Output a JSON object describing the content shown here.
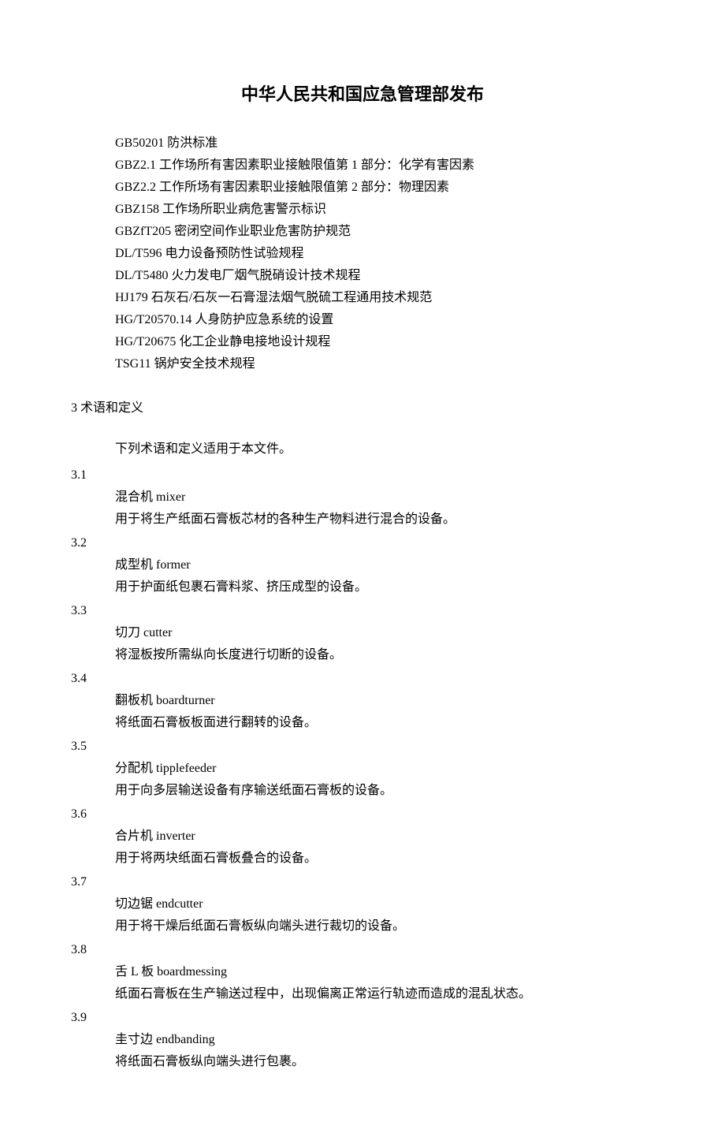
{
  "title": "中华人民共和国应急管理部发布",
  "standards": [
    "GB50201 防洪标准",
    "GBZ2.1 工作场所有害因素职业接触限值第 1 部分：化学有害因素",
    "GBZ2.2 工作所场有害因素职业接触限值第 2 部分：物理因素",
    "GBZ158 工作场所职业病危害警示标识",
    "GBZfT205 密闭空间作业职业危害防护规范",
    "DL/T596 电力设备预防性试验规程",
    "DL/T5480 火力发电厂烟气脱硝设计技术规程",
    "HJ179 石灰石/石灰一石膏湿法烟气脱硫工程通用技术规范",
    "HG/T20570.14 人身防护应急系统的设置",
    "HG/T20675 化工企业静电接地设计规程",
    "TSG11 锅炉安全技术规程"
  ],
  "section3": {
    "heading": "3 术语和定义",
    "intro": "下列术语和定义适用于本文件。",
    "terms": [
      {
        "num": "3.1",
        "name": "混合机 mixer",
        "desc": "用于将生产纸面石膏板芯材的各种生产物料进行混合的设备。"
      },
      {
        "num": "3.2",
        "name": "成型机 former",
        "desc": "用于护面纸包裹石膏料浆、挤压成型的设备。"
      },
      {
        "num": "3.3",
        "name": "切刀 cutter",
        "desc": "将湿板按所需纵向长度进行切断的设备。"
      },
      {
        "num": "3.4",
        "name": "翻板机 boardturner",
        "desc": "将纸面石膏板板面进行翻转的设备。"
      },
      {
        "num": "3.5",
        "name": "分配机 tipplefeeder",
        "desc": "用于向多层输送设备有序输送纸面石膏板的设备。"
      },
      {
        "num": "3.6",
        "name": "合片机 inverter",
        "desc": "用于将两块纸面石膏板叠合的设备。"
      },
      {
        "num": "3.7",
        "name": "切边锯 endcutter",
        "desc": "用于将干燥后纸面石膏板纵向端头进行裁切的设备。"
      },
      {
        "num": "3.8",
        "name": "舌 L 板 boardmessing",
        "desc": "纸面石膏板在生产输送过程中，出现偏离正常运行轨迹而造成的混乱状态。"
      },
      {
        "num": "3.9",
        "name": "圭寸边 endbanding",
        "desc": "将纸面石膏板纵向端头进行包裹。"
      }
    ]
  }
}
